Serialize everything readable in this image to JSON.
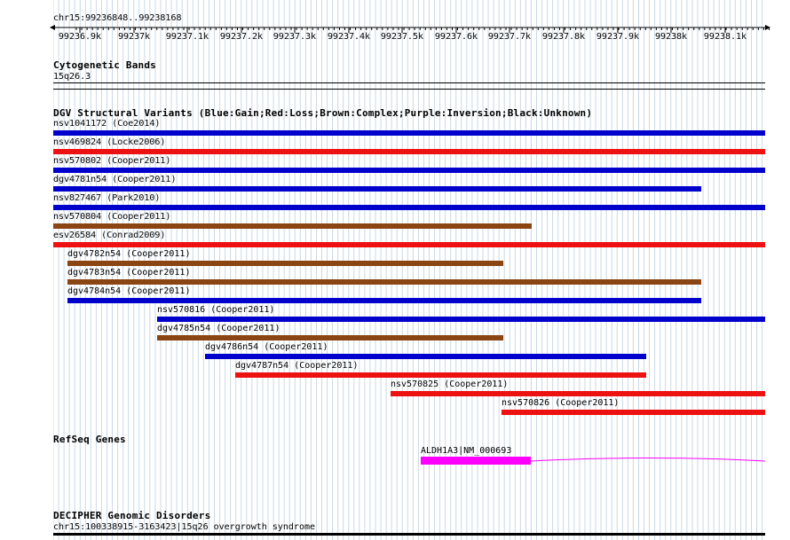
{
  "locus": {
    "label": "chr15:99236848..99238168"
  },
  "ruler": {
    "ticks": [
      "99236.9k",
      "99237k",
      "99237.1k",
      "99237.2k",
      "99237.3k",
      "99237.4k",
      "99237.5k",
      "99237.6k",
      "99237.7k",
      "99237.8k",
      "99237.9k",
      "99238k",
      "99238.1k"
    ]
  },
  "tracks": {
    "cytoband": {
      "title": "Cytogenetic Bands",
      "band": "15q26.3"
    },
    "dgv": {
      "title": "DGV Structural Variants (Blue:Gain;Red:Loss;Brown:Complex;Purple:Inversion;Black:Unknown)",
      "colors": {
        "gain": "#0000cc",
        "loss": "#ee1111",
        "complex": "#8b4513",
        "inversion": "#800080",
        "unknown": "#000000"
      },
      "features": [
        {
          "label": "nsv1041172 (Coe2014)",
          "type": "gain"
        },
        {
          "label": "nsv469824 (Locke2006)",
          "type": "loss"
        },
        {
          "label": "nsv570802 (Cooper2011)",
          "type": "gain"
        },
        {
          "label": "dgv4781n54 (Cooper2011)",
          "type": "gain"
        },
        {
          "label": "nsv827467 (Park2010)",
          "type": "gain"
        },
        {
          "label": "nsv570804 (Cooper2011)",
          "type": "complex"
        },
        {
          "label": "esv26584 (Conrad2009)",
          "type": "loss"
        },
        {
          "label": "dgv4782n54 (Cooper2011)",
          "type": "complex"
        },
        {
          "label": "dgv4783n54 (Cooper2011)",
          "type": "complex"
        },
        {
          "label": "dgv4784n54 (Cooper2011)",
          "type": "gain"
        },
        {
          "label": "nsv570816 (Cooper2011)",
          "type": "gain"
        },
        {
          "label": "dgv4785n54 (Cooper2011)",
          "type": "complex"
        },
        {
          "label": "dgv4786n54 (Cooper2011)",
          "type": "gain"
        },
        {
          "label": "dgv4787n54 (Cooper2011)",
          "type": "loss"
        },
        {
          "label": "nsv570825 (Cooper2011)",
          "type": "loss"
        },
        {
          "label": "nsv570826 (Cooper2011)",
          "type": "loss"
        }
      ]
    },
    "refseq": {
      "title": "RefSeq Genes",
      "gene": "ALDH1A3|NM_000693",
      "color": "#ff00ff"
    },
    "decipher": {
      "title": "DECIPHER Genomic Disorders",
      "feature": "chr15:100338915-3163423|15q26 overgrowth syndrome"
    }
  }
}
